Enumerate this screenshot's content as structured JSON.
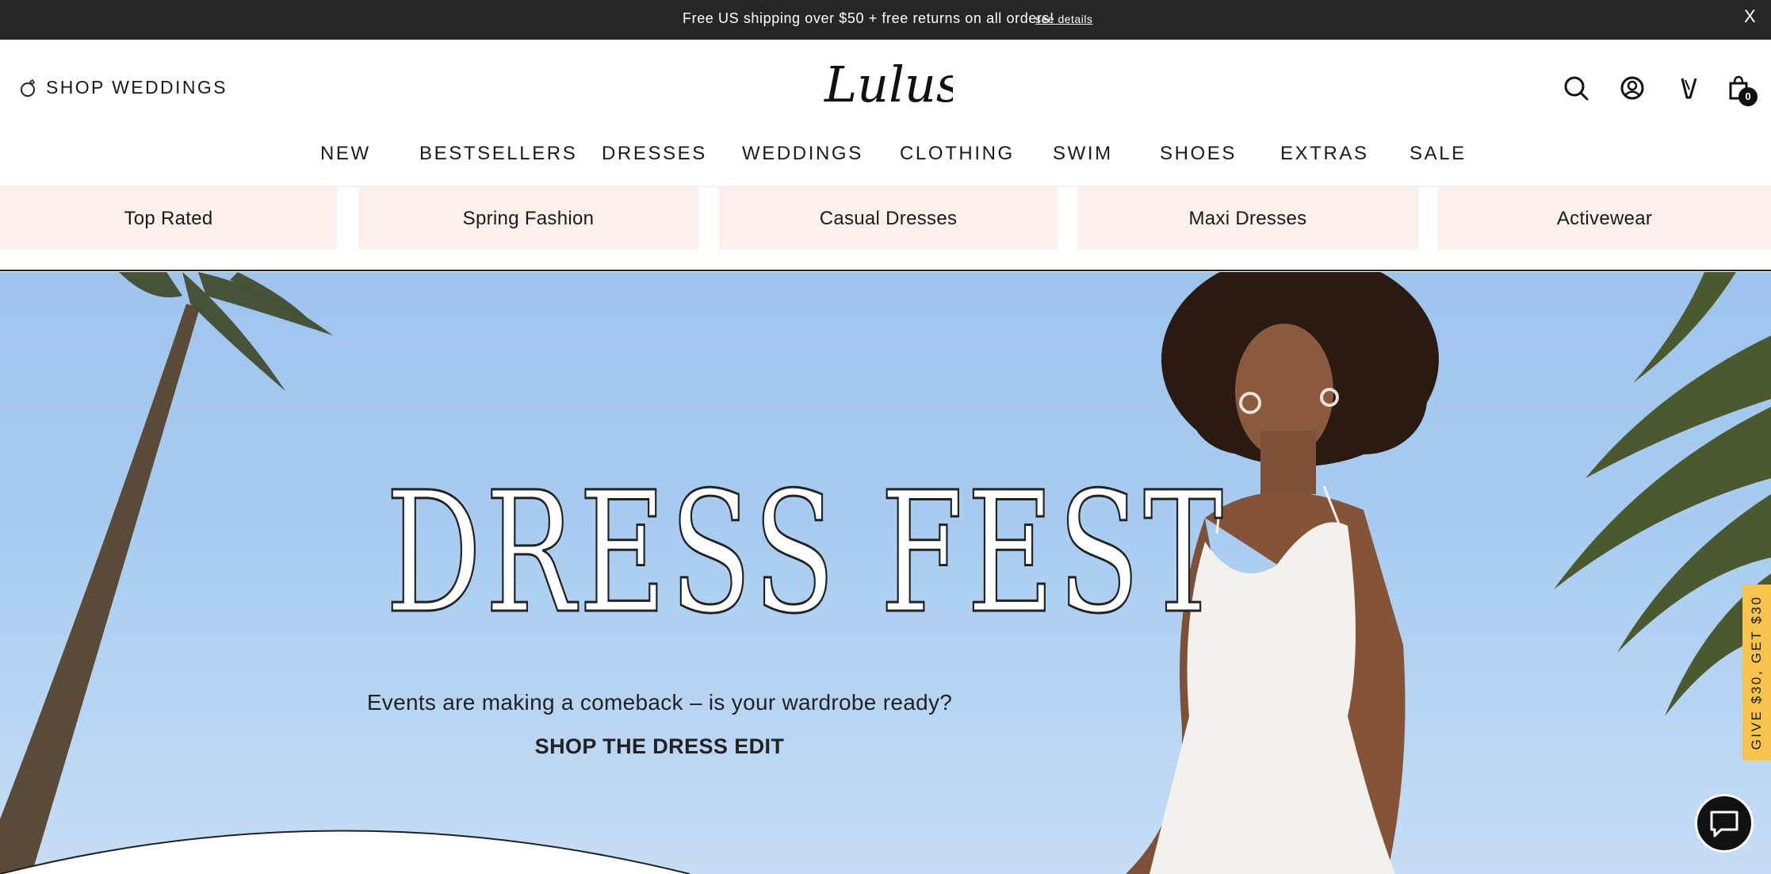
{
  "promo": {
    "text": "Free US shipping over $50 + free returns on all orders!",
    "link": "see details",
    "close": "X"
  },
  "header": {
    "shop_weddings": "SHOP WEDDINGS",
    "logo_text": "Lulus",
    "cart_count": "0",
    "icons": [
      "search-icon",
      "account-icon",
      "wishlist-icon",
      "cart-icon"
    ]
  },
  "nav": {
    "items": [
      "NEW",
      "BESTSELLERS",
      "DRESSES",
      "WEDDINGS",
      "CLOTHING",
      "SWIM",
      "SHOES",
      "EXTRAS",
      "SALE"
    ]
  },
  "categories": [
    "Top Rated",
    "Spring Fashion",
    "Casual Dresses",
    "Maxi Dresses",
    "Activewear"
  ],
  "hero": {
    "title": "DRESS FEST",
    "subtitle": "Events are making a comeback – is your wardrobe ready?",
    "cta": "SHOP THE DRESS EDIT"
  },
  "side_tab": {
    "label": "GIVE $30, GET $30"
  },
  "colors": {
    "promo_bg": "#262626",
    "category_bg": "#fbf0ea",
    "sky": "#a9cdf1",
    "side_tab": "#f8c44d"
  }
}
